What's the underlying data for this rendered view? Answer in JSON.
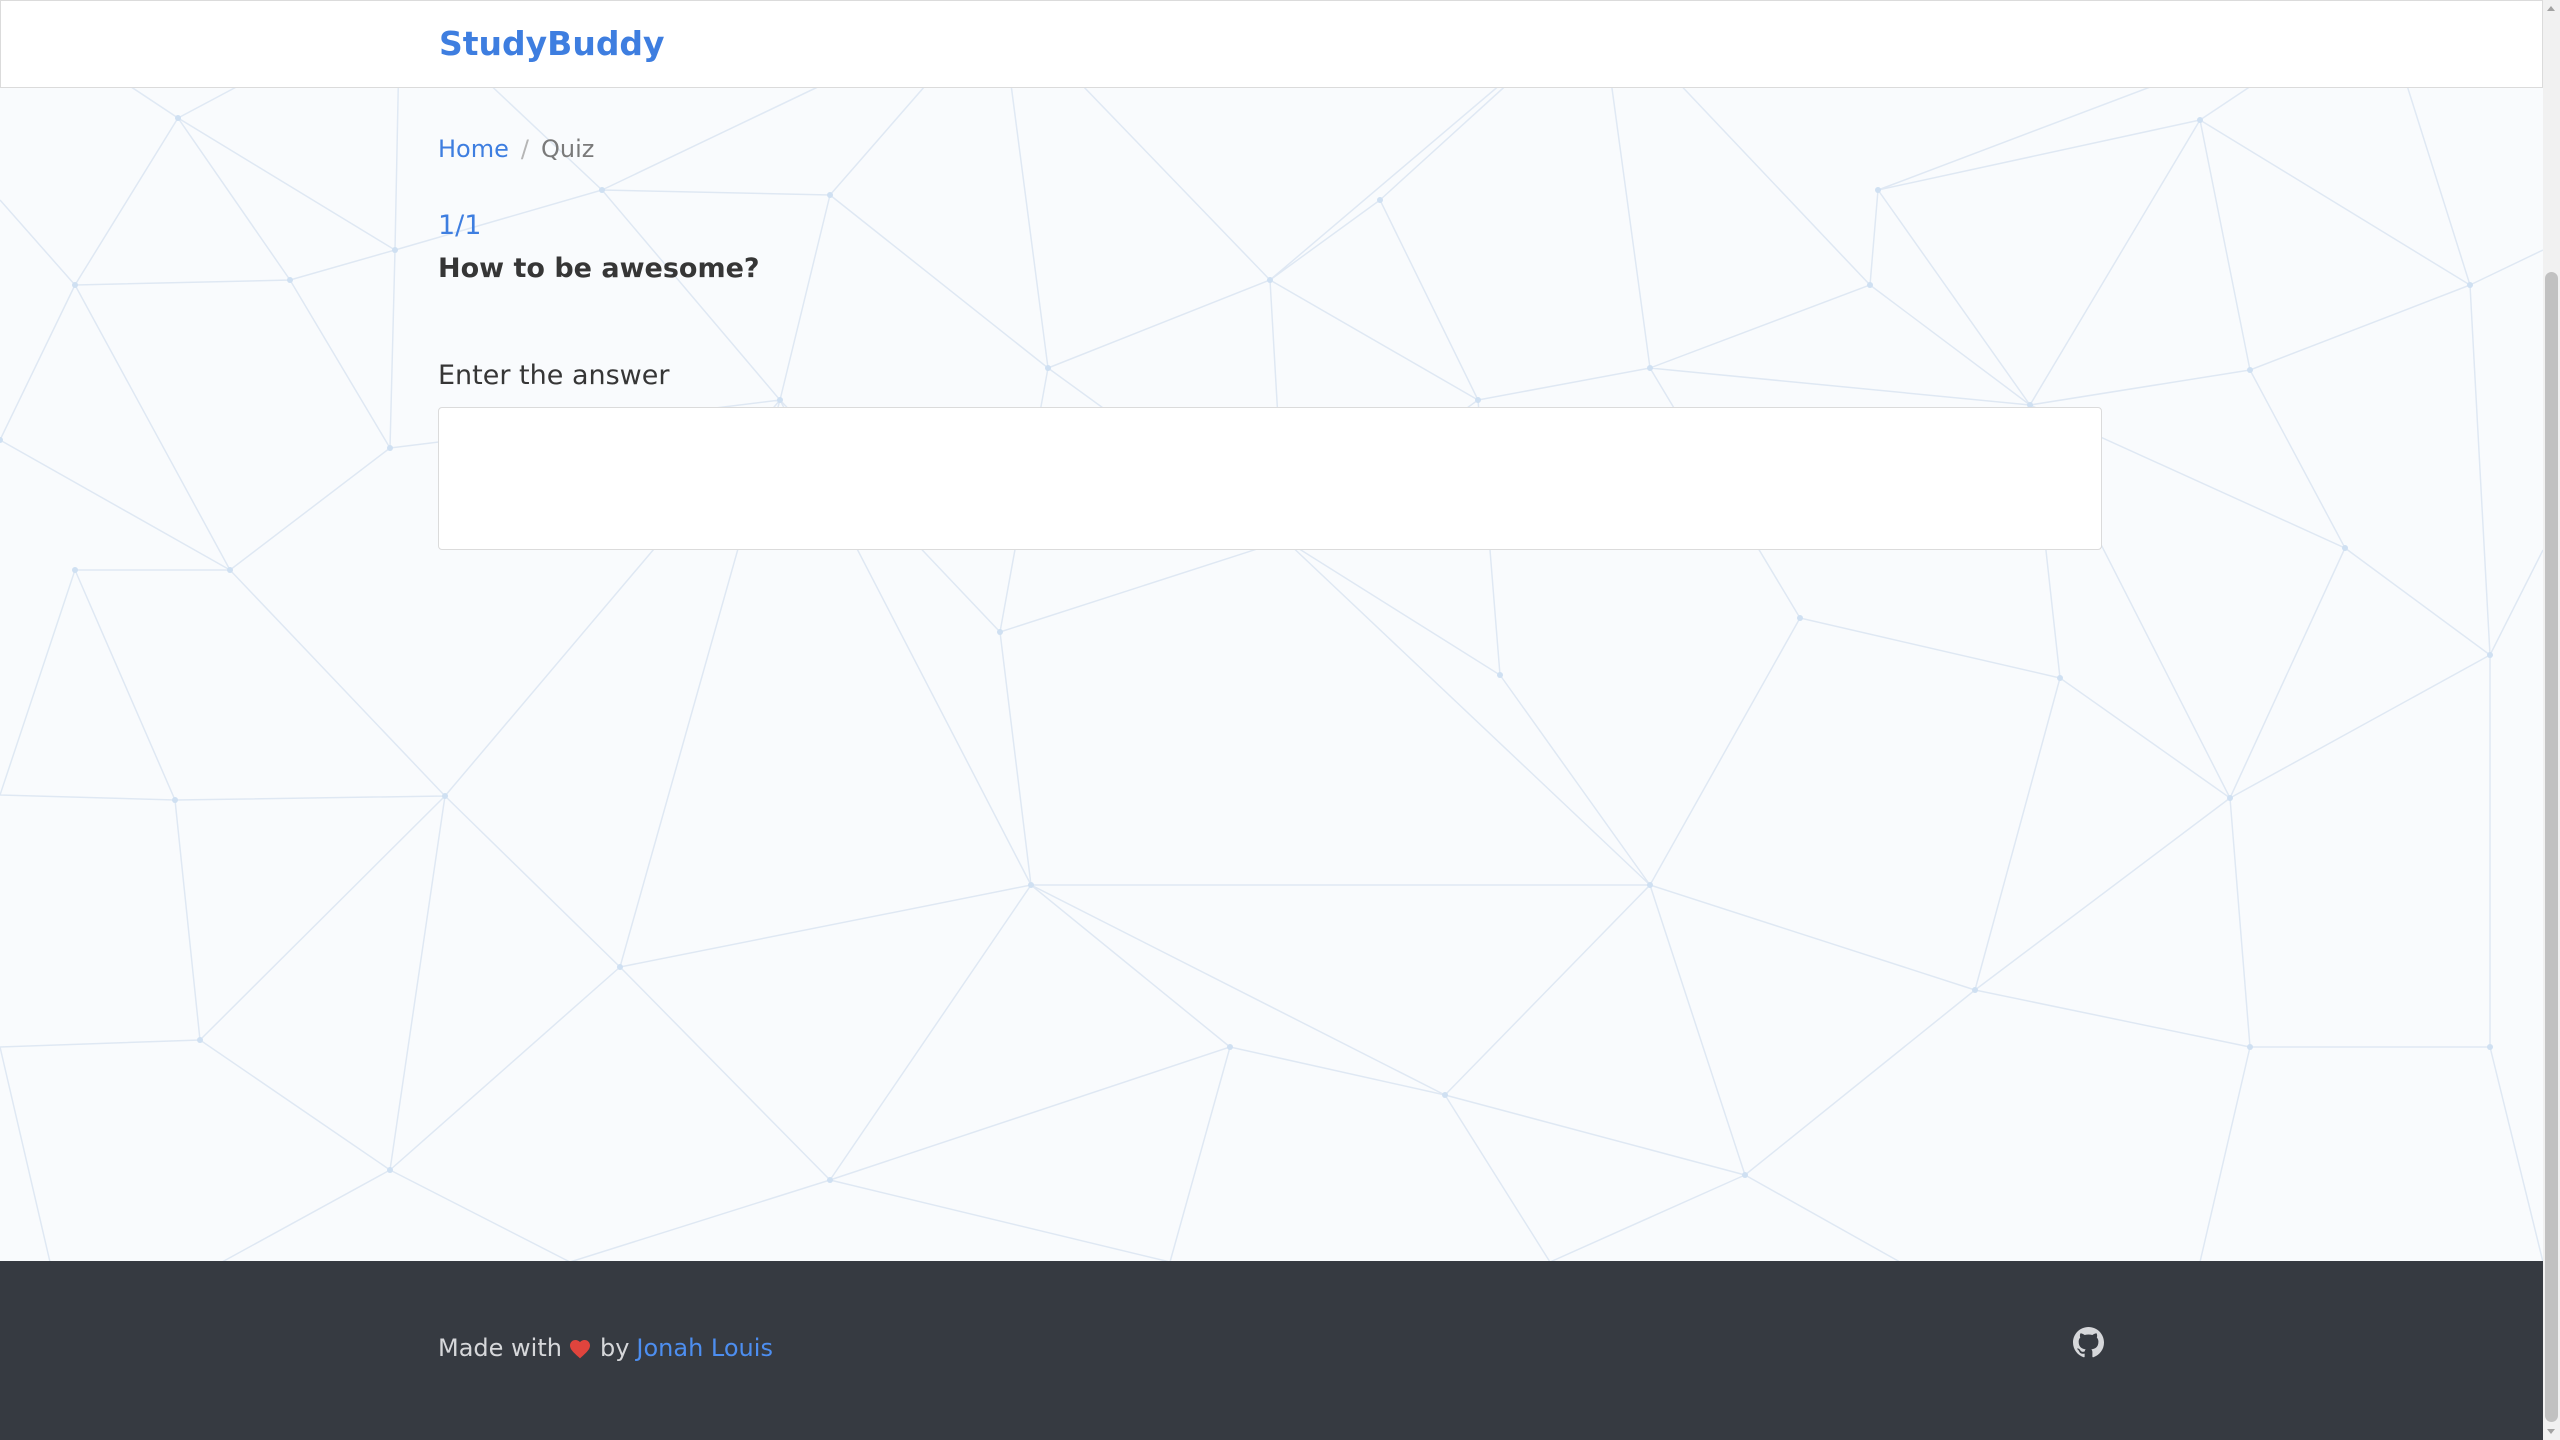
{
  "navbar": {
    "brand": "StudyBuddy"
  },
  "breadcrumb": {
    "items": [
      {
        "label": "Home"
      },
      {
        "label": "Quiz"
      }
    ],
    "separator": "/"
  },
  "quiz": {
    "progress": "1/1",
    "question": "How to be awesome?",
    "answer_label": "Enter the answer",
    "answer_value": ""
  },
  "footer": {
    "made_with": "Made with",
    "by": "by",
    "author": "Jonah Louis",
    "heart_icon": "heart-icon",
    "github_icon": "github-icon"
  },
  "colors": {
    "brand": "#3e7ee0",
    "footer_bg": "#363a41",
    "heart": "#e0443d"
  }
}
